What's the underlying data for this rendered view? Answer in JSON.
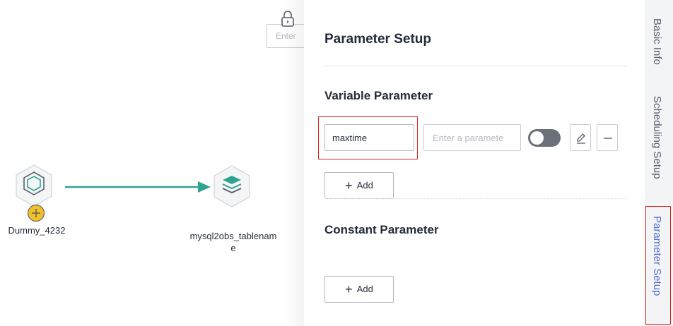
{
  "canvas": {
    "search_placeholder": "Enter",
    "nodes": [
      {
        "label": "Dummy_4232"
      },
      {
        "label_line1": "mysql2obs_tablenam",
        "label_line2": "e"
      }
    ]
  },
  "panel": {
    "title": "Parameter Setup",
    "variable_section": {
      "title": "Variable Parameter",
      "name_value": "maxtime",
      "value_placeholder": "Enter a paramete",
      "add_label": "Add"
    },
    "constant_section": {
      "title": "Constant Parameter",
      "add_label": "Add"
    }
  },
  "side_tabs": [
    {
      "label": "Basic Info"
    },
    {
      "label": "Scheduling Setup"
    },
    {
      "label": "Parameter Setup",
      "active": true
    }
  ],
  "colors": {
    "accent": "#526ecc",
    "edge": "#2fa38f",
    "highlight_border": "#e02020",
    "warning_badge": "#f3c026"
  }
}
